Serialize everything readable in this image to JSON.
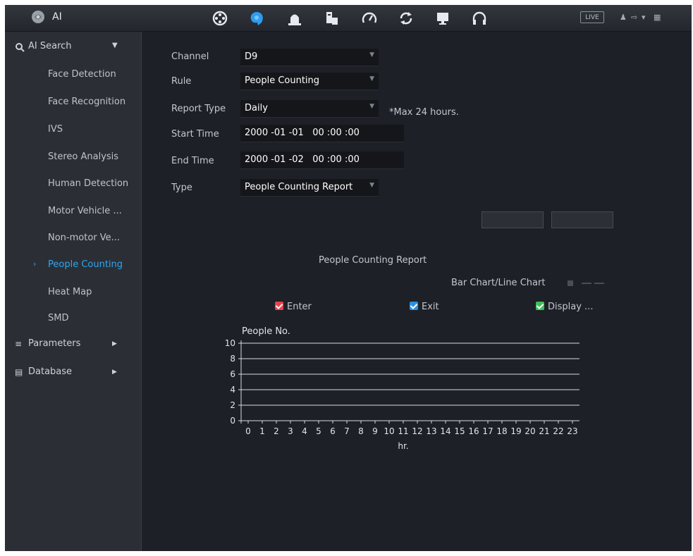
{
  "topbar": {
    "title": "AI",
    "icons": [
      "playback-icon",
      "ai-icon",
      "alarm-icon",
      "storage-icon",
      "performance-icon",
      "backup-icon",
      "display-icon",
      "audio-icon"
    ],
    "live": "LIVE"
  },
  "sidebar": {
    "ai_search": "AI Search",
    "items": [
      {
        "label": "Face Detection"
      },
      {
        "label": "Face Recognition"
      },
      {
        "label": "IVS"
      },
      {
        "label": "Stereo Analysis"
      },
      {
        "label": "Human Detection"
      },
      {
        "label": "Motor Vehicle ..."
      },
      {
        "label": "Non-motor Ve..."
      },
      {
        "label": "People Counting"
      },
      {
        "label": "Heat Map"
      },
      {
        "label": "SMD"
      }
    ],
    "parameters": "Parameters",
    "database": "Database"
  },
  "form": {
    "channel_label": "Channel",
    "channel_value": "D9",
    "rule_label": "Rule",
    "rule_value": "People Counting",
    "report_type_label": "Report Type",
    "report_type_value": "Daily",
    "report_type_note": "*Max 24 hours.",
    "start_time_label": "Start Time",
    "start_time_value": "2000 -01 -01   00 :00 :00",
    "end_time_label": "End Time",
    "end_time_value": "2000 -01 -02   00 :00 :00",
    "type_label": "Type",
    "type_value": "People Counting Report"
  },
  "report": {
    "title": "People Counting Report",
    "bar_line_label": "Bar Chart/Line Chart",
    "legend": [
      {
        "label": "Enter",
        "color": "#e8414a"
      },
      {
        "label": "Exit",
        "color": "#2d8fe0"
      },
      {
        "label": "Display ...",
        "color": "#3ebf5a"
      }
    ]
  },
  "chart_data": {
    "type": "line",
    "title": "",
    "ylabel": "People No.",
    "xlabel": "hr.",
    "x": [
      0,
      1,
      2,
      3,
      4,
      5,
      6,
      7,
      8,
      9,
      10,
      11,
      12,
      13,
      14,
      15,
      16,
      17,
      18,
      19,
      20,
      21,
      22,
      23
    ],
    "ylim": [
      0,
      10
    ],
    "yticks": [
      0,
      2,
      4,
      6,
      8,
      10
    ],
    "grid": true,
    "series": []
  }
}
